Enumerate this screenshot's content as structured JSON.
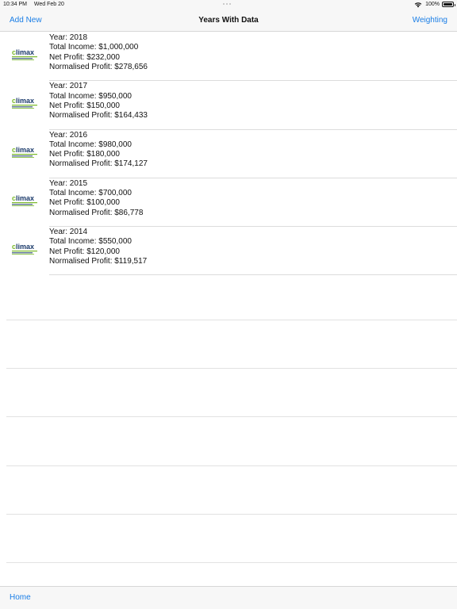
{
  "status_bar": {
    "time": "10:34 PM",
    "date": "Wed Feb 20",
    "battery": "100%",
    "icons": [
      "wifi-icon",
      "battery-icon"
    ]
  },
  "nav": {
    "left_button": "Add New",
    "title": "Years With Data",
    "right_button": "Weighting"
  },
  "logo_icon": "climax-logo",
  "records": [
    {
      "year": "Year: 2018",
      "total_income": "Total Income: $1,000,000",
      "net_profit": "Net Profit: $232,000",
      "normalised_profit": "Normalised Profit: $278,656"
    },
    {
      "year": "Year: 2017",
      "total_income": "Total Income: $950,000",
      "net_profit": "Net Profit: $150,000",
      "normalised_profit": "Normalised Profit: $164,433"
    },
    {
      "year": "Year: 2016",
      "total_income": "Total Income: $980,000",
      "net_profit": "Net Profit: $180,000",
      "normalised_profit": "Normalised Profit: $174,127"
    },
    {
      "year": "Year: 2015",
      "total_income": "Total Income: $700,000",
      "net_profit": "Net Profit: $100,000",
      "normalised_profit": "Normalised Profit: $86,778"
    },
    {
      "year": "Year: 2014",
      "total_income": "Total Income: $550,000",
      "net_profit": "Net Profit: $120,000",
      "normalised_profit": "Normalised Profit: $119,517"
    }
  ],
  "bottom_bar": {
    "home_button": "Home"
  },
  "colors": {
    "accent": "#1a7ee6",
    "logo_green": "#7ab929",
    "logo_navy": "#1b3a6b"
  }
}
